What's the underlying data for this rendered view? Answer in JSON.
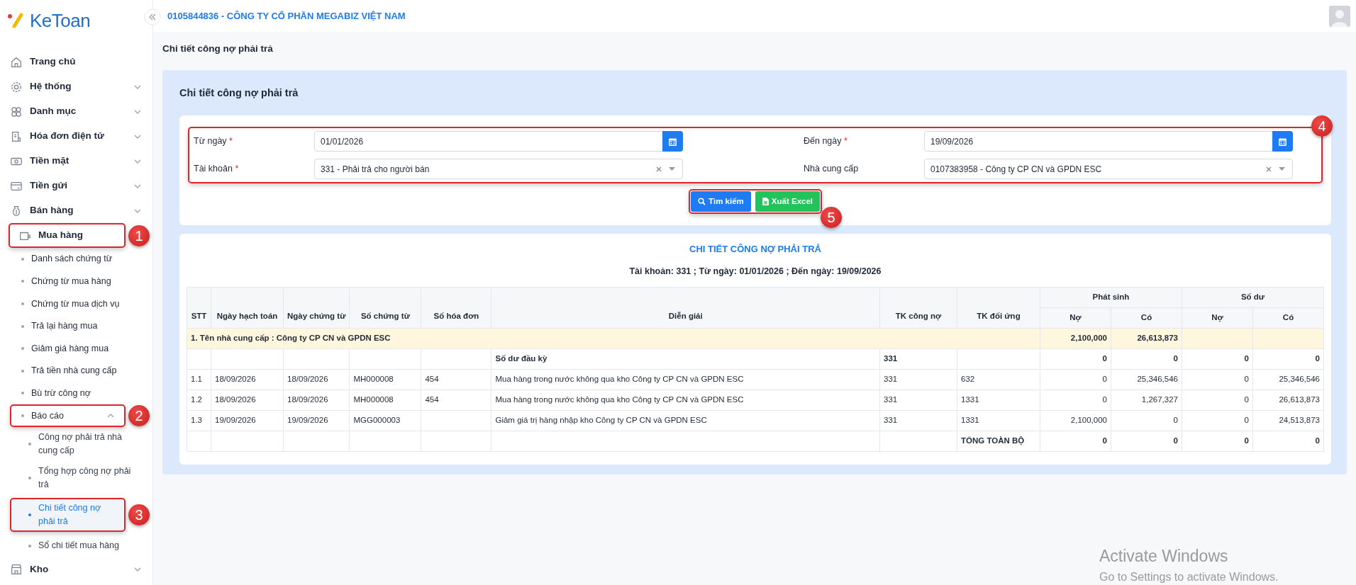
{
  "sidebar": {
    "logo": "KeToan",
    "items": [
      {
        "label": "Trang chủ",
        "kind": "link",
        "selected": false
      },
      {
        "label": "Hệ thống",
        "kind": "group",
        "expanded": false,
        "selected": false
      },
      {
        "label": "Danh mục",
        "kind": "group",
        "expanded": false,
        "selected": false
      },
      {
        "label": "Hóa đơn điện tử",
        "kind": "group",
        "expanded": false,
        "selected": false
      },
      {
        "label": "Tiền mặt",
        "kind": "group",
        "expanded": false,
        "selected": false
      },
      {
        "label": "Tiền gửi",
        "kind": "group",
        "expanded": false,
        "selected": false
      },
      {
        "label": "Bán hàng",
        "kind": "group",
        "expanded": false,
        "selected": false
      },
      {
        "label": "Mua hàng",
        "kind": "group",
        "expanded": true,
        "selected": false,
        "callout": "1",
        "children": [
          {
            "label": "Danh sách chứng từ",
            "selected": false
          },
          {
            "label": "Chứng từ mua hàng",
            "selected": false
          },
          {
            "label": "Chứng từ mua dịch vụ",
            "selected": false
          },
          {
            "label": "Trả lại hàng mua",
            "selected": false
          },
          {
            "label": "Giảm giá hàng mua",
            "selected": false
          },
          {
            "label": "Trả tiền nhà cung cấp",
            "selected": false
          },
          {
            "label": "Bù trừ công nợ",
            "selected": false
          },
          {
            "label": "Báo cáo",
            "selected": false,
            "expanded": true,
            "callout": "2",
            "children": [
              {
                "label": "Công nợ phải trả nhà cung cấp",
                "selected": false
              },
              {
                "label": "Tổng hợp công nợ phải trả",
                "selected": false
              },
              {
                "label": "Chi tiết công nợ phải trả",
                "selected": true,
                "callout": "3"
              },
              {
                "label": "Sổ chi tiết mua hàng",
                "selected": false
              }
            ]
          }
        ]
      },
      {
        "label": "Kho",
        "kind": "group",
        "expanded": false,
        "selected": false
      }
    ]
  },
  "header": {
    "company": "0105844836 - CÔNG TY CỔ PHẦN MEGABIZ VIỆT NAM"
  },
  "page_title": "Chi tiết công nợ phải trả",
  "panel_title": "Chi tiết công nợ phải trả",
  "filters": {
    "callout": "4",
    "fields": [
      {
        "label": "Từ ngày",
        "required_mark": "*",
        "kind": "date",
        "value": "01/01/2026"
      },
      {
        "label": "Đến ngày",
        "required_mark": "*",
        "kind": "date",
        "value": "19/09/2026"
      },
      {
        "label": "Tài khoản",
        "required_mark": "*",
        "kind": "select",
        "value": "331 - Phải trả cho người bán"
      },
      {
        "label": "Nhà cung cấp",
        "kind": "select",
        "value": "0107383958 - Công ty CP CN và GPDN ESC"
      }
    ],
    "buttons_callout": "5",
    "buttons": [
      {
        "label": "Tìm kiếm",
        "kind": "search"
      },
      {
        "label": "Xuất Excel",
        "kind": "excel"
      }
    ]
  },
  "report": {
    "title": "CHI TIẾT CÔNG NỢ PHẢI TRẢ",
    "subtitle": "Tài khoản: 331 ; Từ ngày: 01/01/2026 ; Đến ngày: 19/09/2026",
    "columns": [
      {
        "label": "STT"
      },
      {
        "label": "Ngày hạch toán"
      },
      {
        "label": "Ngày chứng từ"
      },
      {
        "label": "Số chứng từ"
      },
      {
        "label": "Số hóa đơn"
      },
      {
        "label": "Diễn giải"
      },
      {
        "label": "TK công nợ"
      },
      {
        "label": "TK đối ứng"
      },
      {
        "label": "Phát sinh",
        "subcolumns": [
          {
            "label": "Nợ"
          },
          {
            "label": "Có"
          }
        ]
      },
      {
        "label": "Số dư",
        "subcolumns": [
          {
            "label": "Nợ"
          },
          {
            "label": "Có"
          }
        ]
      }
    ],
    "supplier_row": {
      "label": "1. Tên nhà cung cấp : Công ty CP CN và GPDN ESC",
      "debit": "2,100,000",
      "credit": "26,613,873"
    },
    "rows": [
      {
        "kind": "opening",
        "description": "Số dư đầu kỳ",
        "account": "331",
        "ps_debit": "0",
        "ps_credit": "0",
        "bal_debit": "0",
        "bal_credit": "0"
      },
      {
        "kind": "entry",
        "stt": "1.1",
        "posting_date": "18/09/2026",
        "doc_date": "18/09/2026",
        "doc_no": "MH000008",
        "invoice_no": "454",
        "description": "Mua hàng trong nước không qua kho Công ty CP CN và GPDN ESC",
        "account": "331",
        "contra": "632",
        "ps_debit": "0",
        "ps_credit": "25,346,546",
        "bal_debit": "0",
        "bal_credit": "25,346,546"
      },
      {
        "kind": "entry",
        "stt": "1.2",
        "posting_date": "18/09/2026",
        "doc_date": "18/09/2026",
        "doc_no": "MH000008",
        "invoice_no": "454",
        "description": "Mua hàng trong nước không qua kho Công ty CP CN và GPDN ESC",
        "account": "331",
        "contra": "1331",
        "ps_debit": "0",
        "ps_credit": "1,267,327",
        "bal_debit": "0",
        "bal_credit": "26,613,873"
      },
      {
        "kind": "entry",
        "stt": "1.3",
        "posting_date": "19/09/2026",
        "doc_date": "19/09/2026",
        "doc_no": "MGG000003",
        "description": "Giảm giá trị hàng nhập kho Công ty CP CN và GPDN ESC",
        "account": "331",
        "contra": "1331",
        "ps_debit": "2,100,000",
        "ps_credit": "0",
        "bal_debit": "0",
        "bal_credit": "24,513,873"
      },
      {
        "kind": "total",
        "contra": "TỔNG TOÀN BỘ",
        "ps_debit": "0",
        "ps_credit": "0",
        "bal_debit": "0",
        "bal_credit": "0"
      }
    ]
  },
  "os_notice": {
    "title": "Activate Windows",
    "subtitle": "Go to Settings to activate Windows."
  }
}
